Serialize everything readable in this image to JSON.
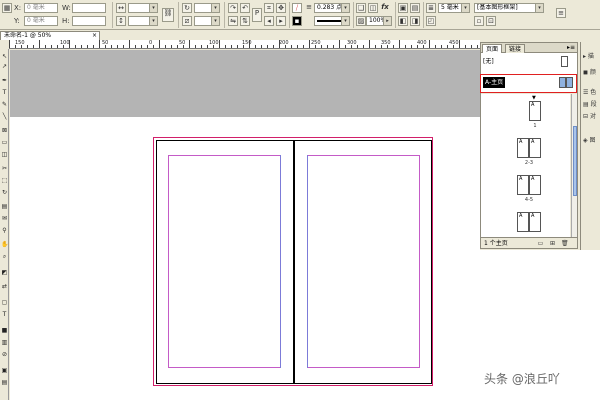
{
  "control_bar": {
    "x_label": "X:",
    "y_label": "Y:",
    "x_value": "0 毫米",
    "y_value": "0 毫米",
    "w_label": "W:",
    "h_label": "H:",
    "stroke_weight": "0.283 点",
    "zoom_percent": "100%",
    "size_value": "5 毫米",
    "frame_style": "[基本图形框架]"
  },
  "document": {
    "tab_title": "未命名-1 @ 50%",
    "close_symbol": "×",
    "ruler_h_numbers": [
      "150",
      "100",
      "50",
      "0",
      "50",
      "100",
      "150",
      "200",
      "250",
      "300",
      "350",
      "400",
      "450"
    ]
  },
  "pages_panel": {
    "tab_pages": "页面",
    "tab_links": "链接",
    "menu_symbol": "▸≡",
    "master_none": "[无]",
    "master_a": "A-主页",
    "page_labels": [
      "1",
      "2-3",
      "4-5"
    ],
    "thumb_letter": "A",
    "page_count": "1 个主页"
  },
  "right_strip": {
    "items": [
      "描",
      "颜",
      "色",
      "段",
      "对",
      "图"
    ]
  },
  "watermark": "头条 @浪丘吖",
  "colors": {
    "bleed": "#d21f6a",
    "margin": "#c45bc7",
    "highlight": "#e02020",
    "pasteboard": "#b4b4b4"
  }
}
